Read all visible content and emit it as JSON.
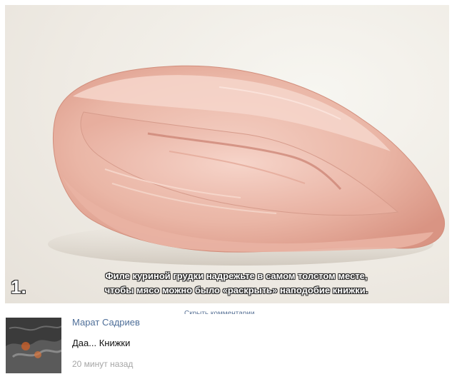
{
  "photo": {
    "alt_icon": "chicken-fillet-photo",
    "caption": {
      "number": "1.",
      "line1": "Филе куриной грудки надрежьте в самом толстом месте,",
      "line2": "чтобы мясо можно было «раскрыть» наподобие книжки."
    }
  },
  "comments_section": {
    "hide_link": "Скрыть комментарии",
    "comment": {
      "author": "Марат Садриев",
      "text": "Даа... Книжки",
      "time": "20 минут назад"
    }
  },
  "colors": {
    "link": "#4f6f99",
    "meta": "#a6a6a6",
    "meat_light": "#f3c6b8",
    "meat_dark": "#dc8f7f"
  }
}
